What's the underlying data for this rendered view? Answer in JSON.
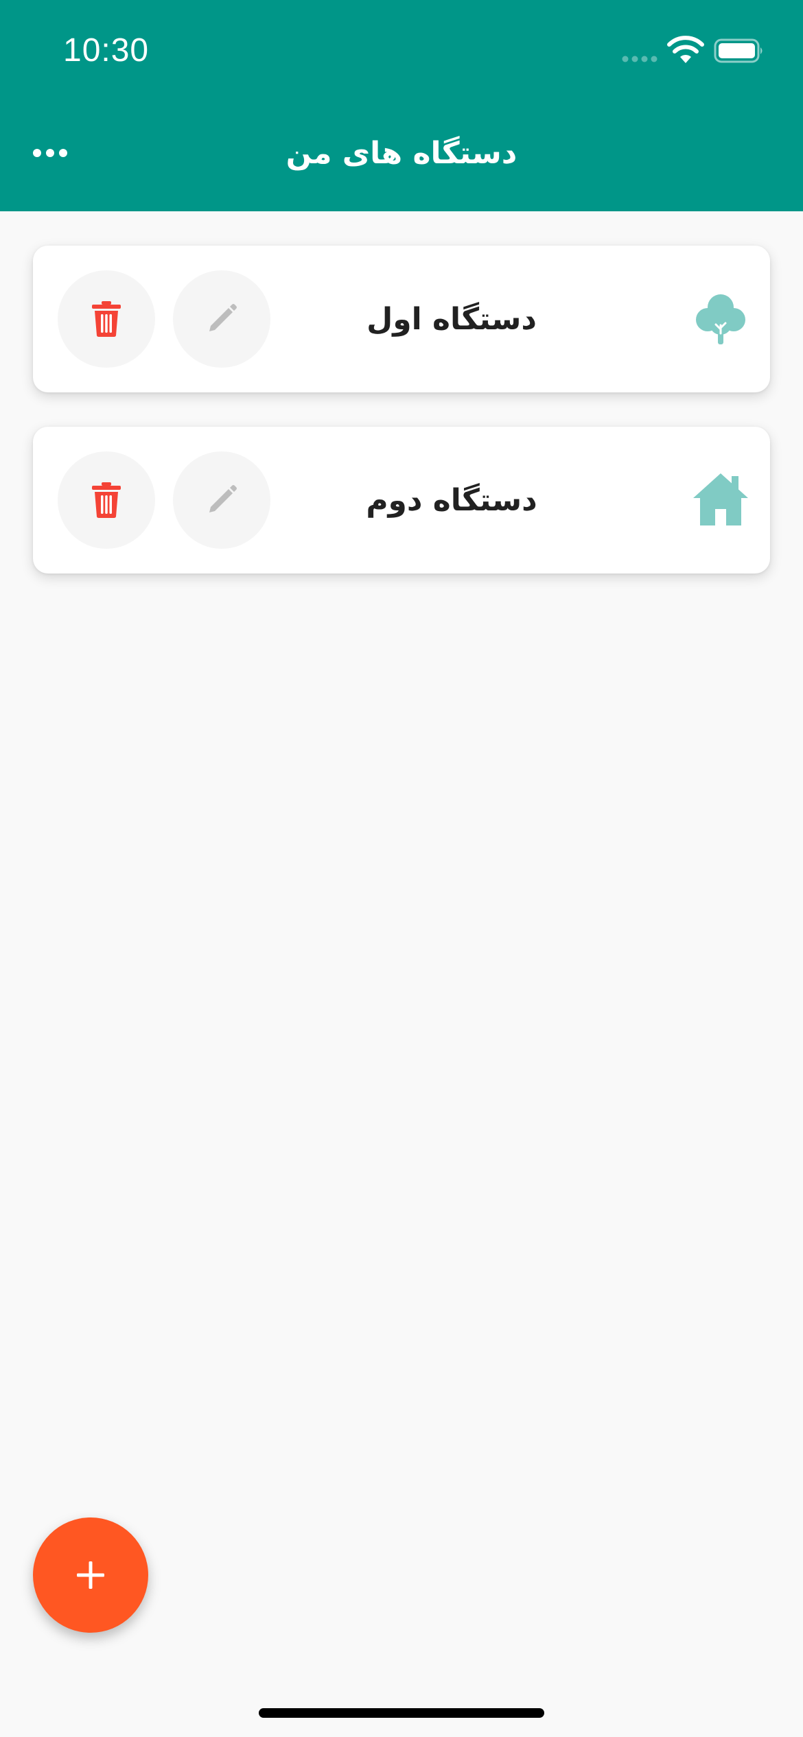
{
  "status_bar": {
    "time": "10:30"
  },
  "app_bar": {
    "title": "دستگاه های من",
    "more_icon": "more-horizontal-icon"
  },
  "devices": [
    {
      "name": "دستگاه اول",
      "type_icon": "tree-icon",
      "edit_icon": "pencil-icon",
      "delete_icon": "trash-icon"
    },
    {
      "name": "دستگاه دوم",
      "type_icon": "home-icon",
      "edit_icon": "pencil-icon",
      "delete_icon": "trash-icon"
    }
  ],
  "fab": {
    "icon": "plus-icon"
  },
  "colors": {
    "primary": "#009688",
    "accent": "#ff5722",
    "delete": "#f44336",
    "device_icon": "#80cbc4",
    "edit_icon": "#bdbdbd",
    "background": "#f9f9f9"
  }
}
